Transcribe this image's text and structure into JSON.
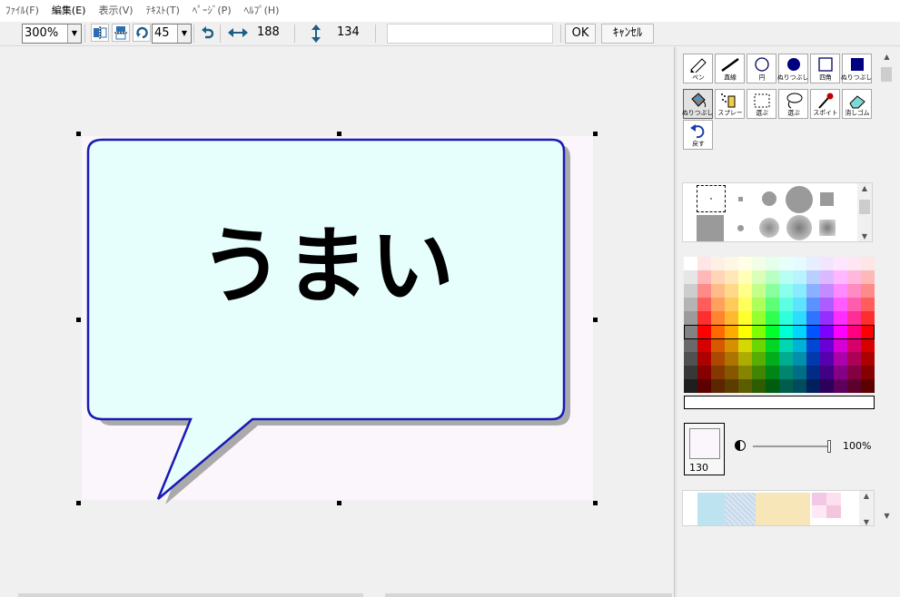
{
  "menu": [
    "ﾌｧｲﾙ(F)",
    "編集(E)",
    "表示(V)",
    "ﾃｷｽﾄ(T)",
    "ﾍﾟｰｼﾞ(P)",
    "ﾍﾙﾌﾟ(H)"
  ],
  "toolbar": {
    "zoom": "300%",
    "angle": "45",
    "width": "188",
    "height": "134",
    "ok_label": "OK",
    "cancel_label": "ｷｬﾝｾﾙ",
    "text_value": ""
  },
  "canvas": {
    "bubble_text": "うまい",
    "bubble_fill": "#e6fefc",
    "bubble_border": "#1a1ab4",
    "background": "#fbf6fb"
  },
  "tools": [
    {
      "label": "ペン",
      "icon": "pen-icon"
    },
    {
      "label": "直線",
      "icon": "line-icon"
    },
    {
      "label": "円",
      "icon": "circle-icon"
    },
    {
      "label": "ぬりつぶし",
      "icon": "filled-circle-icon"
    },
    {
      "label": "四角",
      "icon": "rectangle-icon"
    },
    {
      "label": "ぬりつぶし",
      "icon": "filled-rectangle-icon"
    },
    {
      "label": "ぬりつぶし",
      "icon": "paint-bucket-icon"
    },
    {
      "label": "スプレー",
      "icon": "spray-icon"
    },
    {
      "label": "選ぶ",
      "icon": "rect-select-icon"
    },
    {
      "label": "選ぶ",
      "icon": "lasso-select-icon"
    },
    {
      "label": "スポイト",
      "icon": "eyedropper-icon"
    },
    {
      "label": "消しゴム",
      "icon": "eraser-icon"
    },
    {
      "label": "戻す",
      "icon": "undo-icon"
    }
  ],
  "current_color": {
    "value": "130",
    "hex": "#fbf6fb"
  },
  "opacity": "100%"
}
